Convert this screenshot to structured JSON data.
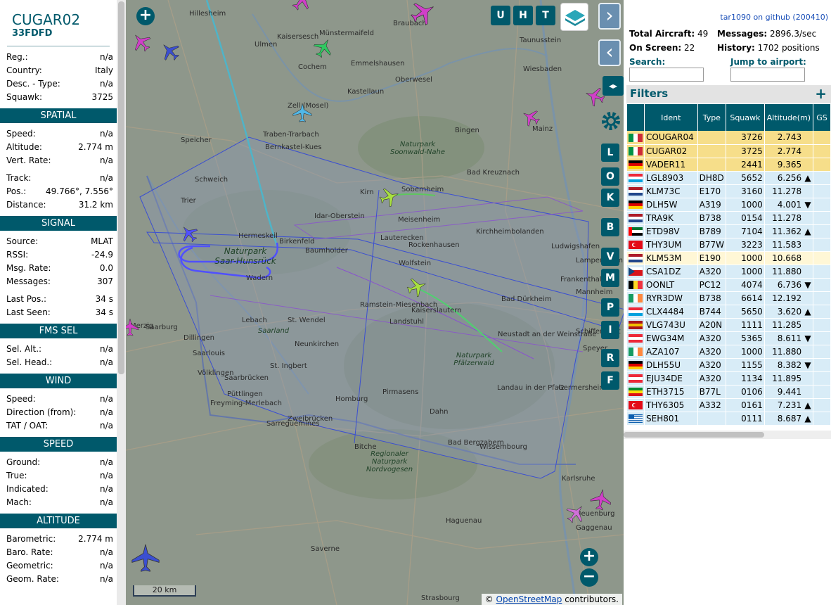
{
  "selected": {
    "callsign": "CUGAR02",
    "hex": "33FDFD",
    "info": [
      {
        "label": "Reg.:",
        "value": "n/a"
      },
      {
        "label": "Country:",
        "value": "Italy"
      },
      {
        "label": "Desc. - Type:",
        "value": "n/a"
      },
      {
        "label": "Squawk:",
        "value": "3725"
      }
    ],
    "sections": [
      {
        "title": "SPATIAL",
        "rows": [
          {
            "label": "Speed:",
            "value": "n/a"
          },
          {
            "label": "Altitude:",
            "value": "2.774 m"
          },
          {
            "label": "Vert. Rate:",
            "value": "n/a"
          },
          {
            "label": "Track:",
            "value": "n/a",
            "gap": true
          },
          {
            "label": "Pos.:",
            "value": "49.766°, 7.556°"
          },
          {
            "label": "Distance:",
            "value": "31.2 km"
          }
        ]
      },
      {
        "title": "SIGNAL",
        "rows": [
          {
            "label": "Source:",
            "value": "MLAT"
          },
          {
            "label": "RSSI:",
            "value": "-24.9"
          },
          {
            "label": "Msg. Rate:",
            "value": "0.0"
          },
          {
            "label": "Messages:",
            "value": "307"
          },
          {
            "label": "Last Pos.:",
            "value": "34 s",
            "gap": true
          },
          {
            "label": "Last Seen:",
            "value": "34 s"
          }
        ]
      },
      {
        "title": "FMS SEL",
        "rows": [
          {
            "label": "Sel. Alt.:",
            "value": "n/a"
          },
          {
            "label": "Sel. Head.:",
            "value": "n/a"
          }
        ]
      },
      {
        "title": "WIND",
        "rows": [
          {
            "label": "Speed:",
            "value": "n/a"
          },
          {
            "label": "Direction (from):",
            "value": "n/a"
          },
          {
            "label": "TAT / OAT:",
            "value": "n/a"
          }
        ]
      },
      {
        "title": "SPEED",
        "rows": [
          {
            "label": "Ground:",
            "value": "n/a"
          },
          {
            "label": "True:",
            "value": "n/a"
          },
          {
            "label": "Indicated:",
            "value": "n/a"
          },
          {
            "label": "Mach:",
            "value": "n/a"
          }
        ]
      },
      {
        "title": "ALTITUDE",
        "rows": [
          {
            "label": "Barometric:",
            "value": "2.774 m"
          },
          {
            "label": "Baro. Rate:",
            "value": "n/a"
          },
          {
            "label": "Geometric:",
            "value": "n/a"
          },
          {
            "label": "Geom. Rate:",
            "value": "n/a"
          }
        ]
      }
    ]
  },
  "map": {
    "top_buttons": [
      "U",
      "H",
      "T"
    ],
    "side_buttons": [
      "L",
      "O",
      "K",
      "B",
      "V",
      "M",
      "P",
      "I",
      "R",
      "F"
    ],
    "scale": "20 km",
    "attribution_prefix": "©",
    "attribution_link": "OpenStreetMap",
    "attribution_suffix": "contributors.",
    "labels": [
      "Hillesheim",
      "Ulmen",
      "Kaisersesch",
      "Cochem",
      "Münstermaifeld",
      "Emmelshausen",
      "Braubach",
      "Taunusstein",
      "Oberwesel",
      "Wiesbaden",
      "Kastellaun",
      "Zell (Mosel)",
      "Bingen",
      "Mainz",
      "Traben-Trarbach",
      "Bernkastel-Kues",
      "Speicher",
      "Schweich",
      "Trier",
      "Kirn",
      "Sobernheim",
      "Bad Kreuznach",
      "Idar-Oberstein",
      "Meisenheim",
      "Kirchheimbolanden",
      "Saarburg",
      "Hermeskeil",
      "Birkenfeld",
      "Baumholder",
      "Lauterecken",
      "Rockenhausen",
      "Wadern",
      "Wolfstein",
      "Mannheim",
      "St. Wendel",
      "Ramstein-Miesenbach",
      "Kaiserslautern",
      "Bad Dürkheim",
      "Merzig",
      "Lebach",
      "Landstuhl",
      "Neustadt an der Weinstraße",
      "Dillingen",
      "Saarlouis",
      "Neunkirchen",
      "Homburg",
      "Speyer",
      "St. Ingbert",
      "Saarbrücken",
      "Pirmasens",
      "Landau in der Pfalz",
      "Germersheim",
      "Zweibrücken",
      "Dahn",
      "Bad Bergzabern",
      "Wissembourg",
      "Karlsruhe",
      "Bitche",
      "Sarreguemines",
      "Haguenau",
      "Saverne",
      "Strasbourg",
      "Lampertheim",
      "Frankenthal",
      "Ludwigshafen",
      "Schifferstadt",
      "Freyming-Merlebach",
      "Neuenburg",
      "Gaggenau",
      "Püttlingen",
      "Völklingen"
    ],
    "parks": [
      "Naturpark Soonwald-Nahe",
      "Naturpark Saar-Hunsrück",
      "Saarland",
      "Naturpark Pfälzerwald",
      "Regionaler Naturpark Nordvogesen"
    ]
  },
  "right": {
    "github": "tar1090 on github (200410)",
    "stats": {
      "total_label": "Total Aircraft:",
      "total": "49",
      "onscreen_label": "On Screen:",
      "onscreen": "22",
      "messages_label": "Messages:",
      "messages": "2896.3/sec",
      "history_label": "History:",
      "history": "1702 positions"
    },
    "search_label": "Search:",
    "jump_label": "Jump to airport:",
    "filters_label": "Filters",
    "filters_plus": "+",
    "columns": [
      "Ident",
      "Type",
      "Squawk",
      "Altitude(m)",
      "GS"
    ],
    "rows": [
      {
        "flag": "it",
        "ident": "COUGAR04",
        "type": "",
        "squawk": "3726",
        "alt": "2.743",
        "trend": "",
        "style": "sq"
      },
      {
        "flag": "it",
        "ident": "CUGAR02",
        "type": "",
        "squawk": "3725",
        "alt": "2.774",
        "trend": "",
        "style": "sq"
      },
      {
        "flag": "de",
        "ident": "VADER11",
        "type": "",
        "squawk": "2441",
        "alt": "9.365",
        "trend": "",
        "style": "sq"
      },
      {
        "flag": "lu",
        "ident": "LGL8903",
        "type": "DH8D",
        "squawk": "5652",
        "alt": "6.256",
        "trend": "▲",
        "style": "norm"
      },
      {
        "flag": "nl",
        "ident": "KLM73C",
        "type": "E170",
        "squawk": "3160",
        "alt": "11.278",
        "trend": "",
        "style": "norm"
      },
      {
        "flag": "de",
        "ident": "DLH5W",
        "type": "A319",
        "squawk": "1000",
        "alt": "4.001",
        "trend": "▼",
        "style": "norm"
      },
      {
        "flag": "nl",
        "ident": "TRA9K",
        "type": "B738",
        "squawk": "0154",
        "alt": "11.278",
        "trend": "",
        "style": "norm"
      },
      {
        "flag": "ae",
        "ident": "ETD98V",
        "type": "B789",
        "squawk": "7104",
        "alt": "11.362",
        "trend": "▲",
        "style": "norm"
      },
      {
        "flag": "tr",
        "ident": "THY3UM",
        "type": "B77W",
        "squawk": "3223",
        "alt": "11.583",
        "trend": "",
        "style": "norm"
      },
      {
        "flag": "nl",
        "ident": "KLM53M",
        "type": "E190",
        "squawk": "1000",
        "alt": "10.668",
        "trend": "",
        "style": "sel"
      },
      {
        "flag": "cz",
        "ident": "CSA1DZ",
        "type": "A320",
        "squawk": "1000",
        "alt": "11.880",
        "trend": "",
        "style": "norm"
      },
      {
        "flag": "be",
        "ident": "OONLT",
        "type": "PC12",
        "squawk": "4074",
        "alt": "6.736",
        "trend": "▼",
        "style": "norm"
      },
      {
        "flag": "ie",
        "ident": "RYR3DW",
        "type": "B738",
        "squawk": "6614",
        "alt": "12.192",
        "trend": "",
        "style": "norm"
      },
      {
        "flag": "lu",
        "ident": "CLX4484",
        "type": "B744",
        "squawk": "5650",
        "alt": "3.620",
        "trend": "▲",
        "style": "norm"
      },
      {
        "flag": "es",
        "ident": "VLG743U",
        "type": "A20N",
        "squawk": "1111",
        "alt": "11.285",
        "trend": "",
        "style": "norm"
      },
      {
        "flag": "at",
        "ident": "EWG34M",
        "type": "A320",
        "squawk": "5365",
        "alt": "8.611",
        "trend": "▼",
        "style": "norm"
      },
      {
        "flag": "ie",
        "ident": "AZA107",
        "type": "A320",
        "squawk": "1000",
        "alt": "11.880",
        "trend": "",
        "style": "norm"
      },
      {
        "flag": "de",
        "ident": "DLH55U",
        "type": "A320",
        "squawk": "1155",
        "alt": "8.382",
        "trend": "▼",
        "style": "norm"
      },
      {
        "flag": "at",
        "ident": "EJU34DE",
        "type": "A320",
        "squawk": "1134",
        "alt": "11.895",
        "trend": "",
        "style": "norm"
      },
      {
        "flag": "et",
        "ident": "ETH3715",
        "type": "B77L",
        "squawk": "0106",
        "alt": "9.441",
        "trend": "",
        "style": "norm"
      },
      {
        "flag": "tr",
        "ident": "THY6305",
        "type": "A332",
        "squawk": "0161",
        "alt": "7.231",
        "trend": "▲",
        "style": "norm"
      },
      {
        "flag": "gr",
        "ident": "SEH801",
        "type": "",
        "squawk": "0111",
        "alt": "8.687",
        "trend": "▲",
        "style": "norm"
      }
    ]
  },
  "colors": {
    "accent": "#00596b",
    "squawk_row": "#f6de8a",
    "row": "#d8ecf7",
    "selected_row": "#fff7d6"
  }
}
